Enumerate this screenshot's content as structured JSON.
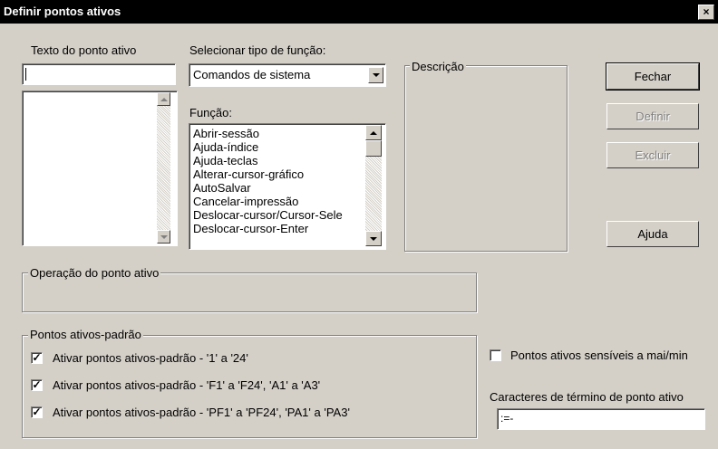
{
  "window": {
    "title": "Definir pontos ativos",
    "close_glyph": "×"
  },
  "hotspot_text": {
    "label": "Texto do ponto ativo",
    "value": ""
  },
  "function_type": {
    "label": "Selecionar tipo de função:",
    "selected": "Comandos de sistema"
  },
  "function": {
    "label": "Função:",
    "items": [
      "Abrir-sessão",
      "Ajuda-índice",
      "Ajuda-teclas",
      "Alterar-cursor-gráfico",
      "AutoSalvar",
      "Cancelar-impressão",
      "Deslocar-cursor/Cursor-Sele",
      "Deslocar-cursor-Enter"
    ]
  },
  "description": {
    "label": "Descrição"
  },
  "buttons": {
    "close": "Fechar",
    "define": "Definir",
    "delete": "Excluir",
    "help": "Ajuda"
  },
  "operation": {
    "label": "Operação do ponto ativo"
  },
  "defaults": {
    "label": "Pontos ativos-padrão",
    "options": [
      {
        "label": "Ativar pontos ativos-padrão - '1' a '24'",
        "checked": true
      },
      {
        "label": "Ativar pontos ativos-padrão - 'F1' a 'F24', 'A1' a 'A3'",
        "checked": true
      },
      {
        "label": "Ativar pontos ativos-padrão - 'PF1' a 'PF24', 'PA1' a 'PA3'",
        "checked": true
      }
    ]
  },
  "case_sensitive": {
    "label": "Pontos ativos sensíveis a mai/min",
    "checked": false
  },
  "terminators": {
    "label": "Caracteres de término de ponto ativo",
    "value": " :=-"
  }
}
